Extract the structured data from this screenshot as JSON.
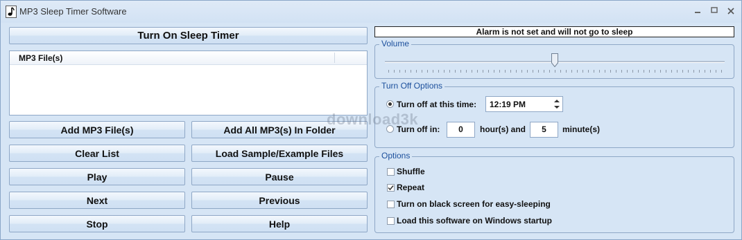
{
  "window": {
    "title": "MP3 Sleep Timer Software"
  },
  "left": {
    "turn_on_button": "Turn On Sleep Timer",
    "list": {
      "column_header": "MP3 File(s)",
      "items": []
    },
    "buttons": {
      "add_files": "Add MP3 File(s)",
      "add_folder": "Add All MP3(s) In Folder",
      "clear_list": "Clear List",
      "load_sample": "Load Sample/Example Files",
      "play": "Play",
      "pause": "Pause",
      "next": "Next",
      "previous": "Previous",
      "stop": "Stop",
      "help": "Help"
    }
  },
  "status": {
    "text": "Alarm is not set and will not go to sleep"
  },
  "volume": {
    "title": "Volume",
    "level": 0.5
  },
  "turn_off": {
    "title": "Turn Off Options",
    "at_time": {
      "label": "Turn off at this time:",
      "value": "12:19 PM",
      "selected": true
    },
    "in": {
      "label": "Turn off in:",
      "hours": "0",
      "hours_label": "hour(s) and",
      "minutes": "5",
      "minutes_label": "minute(s)",
      "selected": false
    }
  },
  "options": {
    "title": "Options",
    "items": [
      {
        "label": "Shuffle",
        "checked": false
      },
      {
        "label": "Repeat",
        "checked": true
      },
      {
        "label": "Turn on black screen for easy-sleeping",
        "checked": false
      },
      {
        "label": "Load this software on Windows startup",
        "checked": false
      }
    ]
  },
  "watermark": "download3k",
  "colors": {
    "group_title": "#1b4f9c",
    "window_bg": "#d6e5f5",
    "border": "#8ea7c6"
  }
}
